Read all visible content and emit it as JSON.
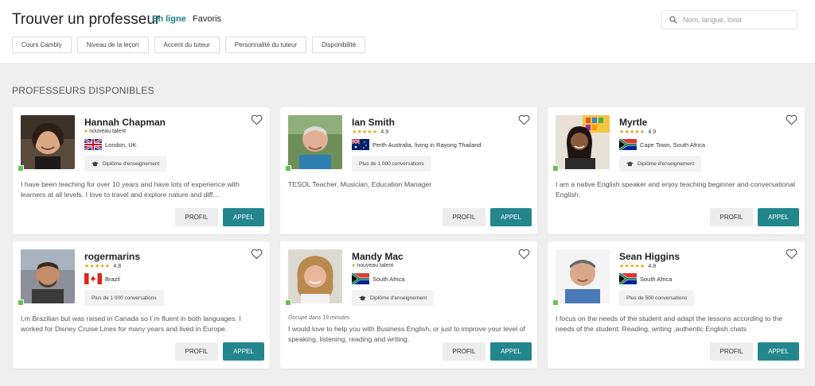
{
  "header": {
    "title": "Trouver un professeur",
    "tabs": {
      "online": "En ligne",
      "favorites": "Favoris"
    },
    "search_placeholder": "Nom, langue, loisir"
  },
  "filters": [
    "Cours Cambly",
    "Niveau de la leçon",
    "Accent du tuteur",
    "Personnalité du tuteur",
    "Disponibilité"
  ],
  "section_title": "PROFESSEURS DISPONIBLES",
  "buttons": {
    "profile": "PROFIL",
    "call": "APPEL"
  },
  "colors": {
    "accent": "#24868d",
    "online": "#6cbf5a",
    "star": "#e8a317"
  },
  "tutors": [
    {
      "name": "Hannah Chapman",
      "status": "nouveau talent",
      "rating": "",
      "location": "London, UK",
      "flag": "uk-flag-icon",
      "badge": "Diplôme d'enseignement",
      "busy": "",
      "description": "I have been teaching for over 10 years and have lots of experience with learners at all levels. I love to travel and explore nature and diff..."
    },
    {
      "name": "Ian Smith",
      "status": "",
      "rating": "4.9",
      "location": "Perth Australia, living in Rayong Thailand",
      "flag": "australia-flag-icon",
      "badge": "Plus de 1 000 conversations",
      "busy": "",
      "description": "TESOL Teacher, Musician, Education Manager"
    },
    {
      "name": "Myrtle",
      "status": "",
      "rating": "4.9",
      "location": "Cape Town, South Africa",
      "flag": "south-africa-flag-icon",
      "badge": "Diplôme d'enseignement",
      "busy": "",
      "description": "I am a native English speaker and enjoy teaching beginner and conversational English."
    },
    {
      "name": "rogermarins",
      "status": "",
      "rating": "4.8",
      "location": "Brazil",
      "flag": "canada-flag-icon",
      "badge": "Plus de 1 000 conversations",
      "busy": "",
      "description": "I,m Brazilian but was raised in Canada so I´m fluent in both languages. I worked for Disney Cruise Lines for many years and lived in Europe."
    },
    {
      "name": "Mandy Mac",
      "status": "nouveau talent",
      "rating": "",
      "location": "South Africa",
      "flag": "south-africa-flag-icon",
      "badge": "Diplôme d'enseignement",
      "busy": "Occupé dans 19 minutes",
      "description": "I would love to help you with Business English, or just to improve your level of speaking, listening, reading and writing."
    },
    {
      "name": "Sean Higgins",
      "status": "",
      "rating": "4.8",
      "location": "South Africa",
      "flag": "south-africa-flag-icon",
      "badge": "Plus de 500 conversations",
      "busy": "",
      "description": "I focus on the needs of the student and adapt the lessons according to the needs of the student: Reading, writing ,authentic English chats"
    }
  ]
}
